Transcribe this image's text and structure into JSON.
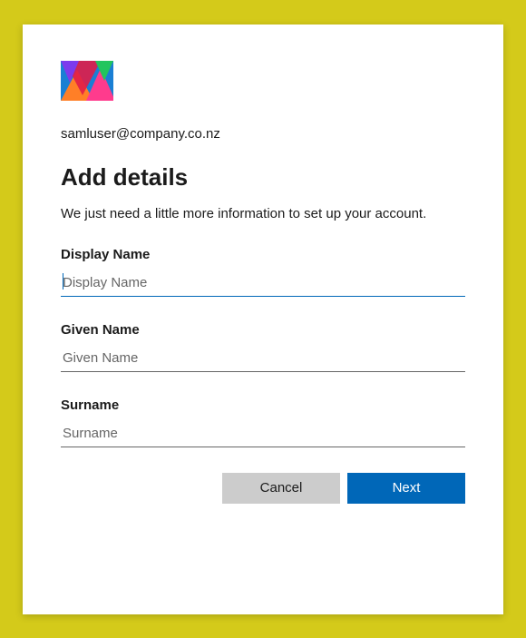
{
  "email": "samluser@company.co.nz",
  "title": "Add details",
  "subtitle": "We just need a little more information to set up your account.",
  "fields": {
    "displayName": {
      "label": "Display Name",
      "placeholder": "Display Name",
      "value": ""
    },
    "givenName": {
      "label": "Given Name",
      "placeholder": "Given Name",
      "value": ""
    },
    "surname": {
      "label": "Surname",
      "placeholder": "Surname",
      "value": ""
    }
  },
  "buttons": {
    "cancel": "Cancel",
    "next": "Next"
  },
  "colors": {
    "accent": "#0067b8",
    "pageBackground": "#d4ca1a"
  }
}
